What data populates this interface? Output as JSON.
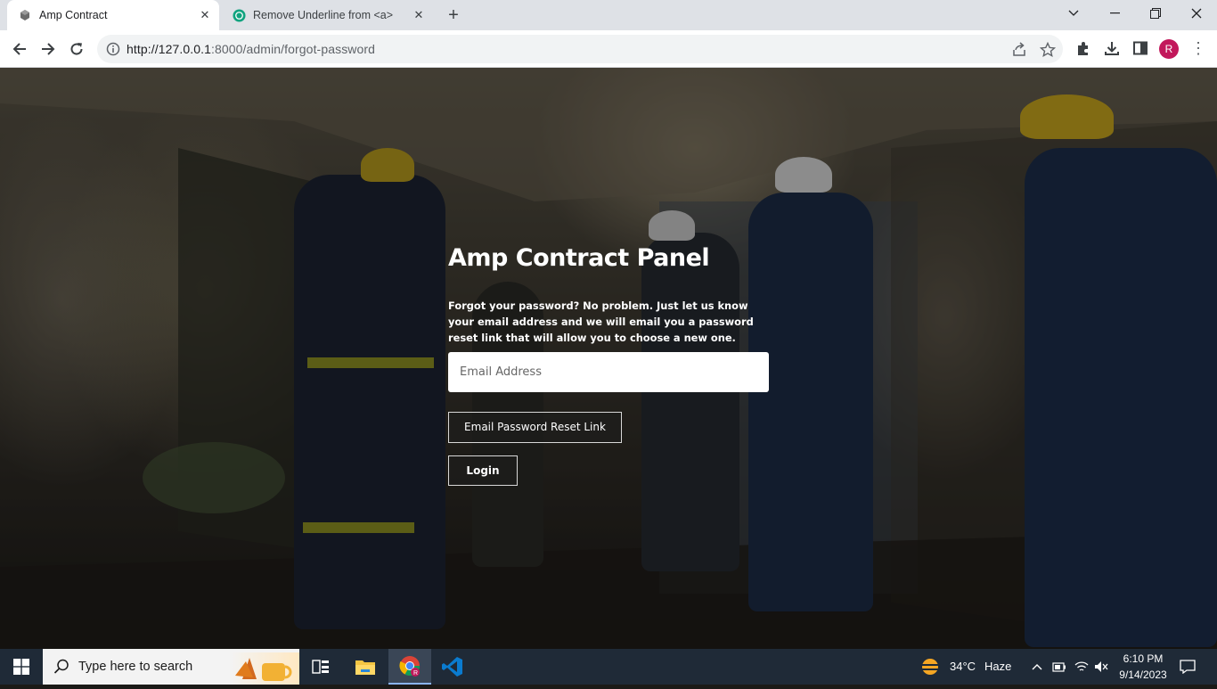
{
  "browser": {
    "tabs": [
      {
        "title": "Amp Contract",
        "active": true
      },
      {
        "title": "Remove Underline from <a>",
        "active": false
      }
    ],
    "url": {
      "host": "http://127.0.0.1",
      "path": ":8000/admin/forgot-password"
    },
    "profile_initial": "R"
  },
  "page": {
    "title": "Amp Contract Panel",
    "description": "Forgot your password? No problem. Just let us know your email address and we will email you a password reset link that will allow you to choose a new one.",
    "email_placeholder": "Email Address",
    "email_value": "",
    "reset_button": "Email Password Reset Link",
    "login_button": "Login"
  },
  "taskbar": {
    "search_placeholder": "Type here to search",
    "weather": {
      "temp": "34°C",
      "condition": "Haze"
    },
    "time": "6:10 PM",
    "date": "9/14/2023"
  },
  "colors": {
    "tabbar_bg": "#dee1e6",
    "taskbar_bg": "#1f2a37",
    "profile_bg": "#c2185b"
  },
  "icons": [
    "amp-favicon-icon",
    "chatgpt-favicon-icon",
    "close-icon",
    "plus-icon",
    "chevron-down-icon",
    "minimize-icon",
    "restore-icon",
    "back-icon",
    "forward-icon",
    "reload-icon",
    "info-icon",
    "share-icon",
    "star-icon",
    "extensions-icon",
    "download-icon",
    "sidepanel-icon",
    "menu-icon",
    "windows-start-icon",
    "search-icon",
    "task-view-icon",
    "file-explorer-icon",
    "chrome-icon",
    "vscode-icon",
    "weather-icon",
    "chevron-up-icon",
    "battery-icon",
    "wifi-icon",
    "volume-icon",
    "notification-icon"
  ]
}
